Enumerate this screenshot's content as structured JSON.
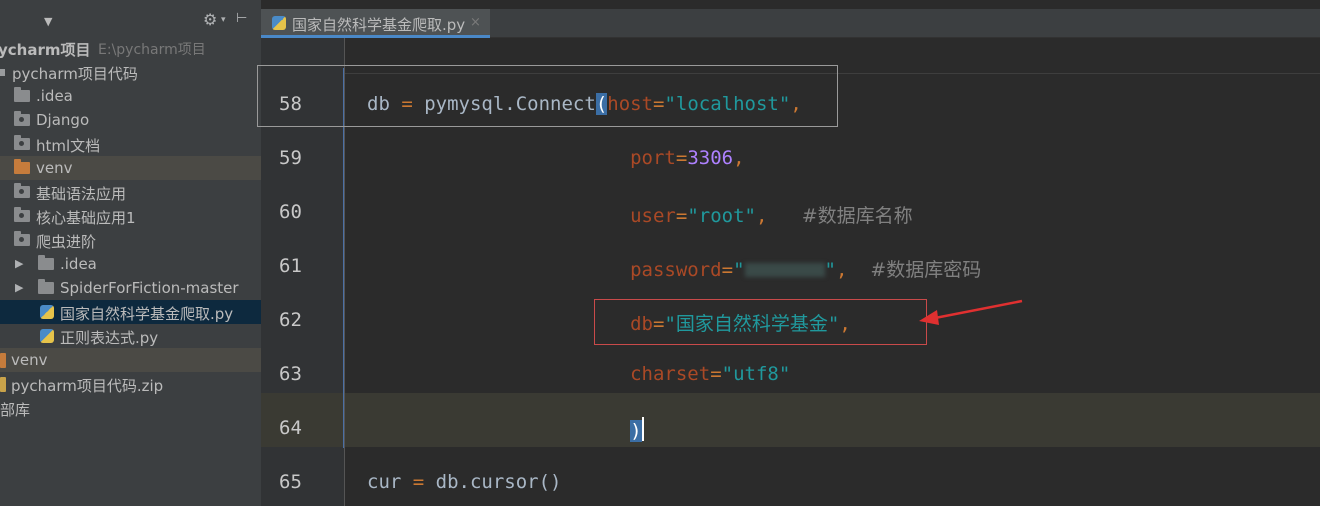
{
  "sidebar": {
    "header": {
      "caret_icon": "chevron-down-icon",
      "gear_icon": "gear-icon",
      "collapse_icon": "collapse-all-icon"
    },
    "items": [
      {
        "label": "ycharm项目",
        "sub": "E:\\pycharm项目"
      },
      {
        "label": "pycharm项目代码"
      },
      {
        "label": ".idea"
      },
      {
        "label": "Django"
      },
      {
        "label": "html文档"
      },
      {
        "label": "venv"
      },
      {
        "label": "基础语法应用"
      },
      {
        "label": "核心基础应用1"
      },
      {
        "label": "爬虫进阶"
      },
      {
        "label": ".idea"
      },
      {
        "label": "SpiderForFiction-master"
      },
      {
        "label": "国家自然科学基金爬取.py"
      },
      {
        "label": "正则表达式.py"
      },
      {
        "label": "venv"
      },
      {
        "label": "pycharm项目代码.zip"
      },
      {
        "label": "部库"
      }
    ]
  },
  "editor": {
    "tab": {
      "label": "国家自然科学基金爬取.py",
      "close": "×"
    },
    "lines": [
      {
        "num": "58",
        "indent": "",
        "parts": [
          "db",
          " = ",
          "pymysql.Connect",
          "(",
          "host",
          "=",
          "\"localhost\"",
          ","
        ]
      },
      {
        "num": "59",
        "indent": "                       ",
        "parts": [
          "port",
          "=",
          "3306",
          ","
        ]
      },
      {
        "num": "60",
        "indent": "                       ",
        "parts": [
          "user",
          "=",
          "\"root\"",
          ",",
          "   ",
          "#数据库名称"
        ]
      },
      {
        "num": "61",
        "indent": "                       ",
        "parts": [
          "password",
          "=",
          "\"",
          "\"",
          ",",
          "  ",
          "#数据库密码"
        ]
      },
      {
        "num": "62",
        "indent": "                       ",
        "parts": [
          "db",
          "=",
          "\"国家自然科学基金\"",
          ","
        ]
      },
      {
        "num": "63",
        "indent": "                       ",
        "parts": [
          "charset",
          "=",
          "\"utf8\""
        ]
      },
      {
        "num": "64",
        "indent": "                       ",
        "parts": [
          ")"
        ]
      },
      {
        "num": "65",
        "indent": "",
        "parts": [
          "cur",
          " = ",
          "db.cursor()"
        ]
      }
    ]
  },
  "colors": {
    "background": "#2b2b2b",
    "sidebar": "#3c3f41",
    "keyword": "#cc7832",
    "string": "#6a8759",
    "number": "#6897bb",
    "annotation_box": "#c94a4a"
  }
}
